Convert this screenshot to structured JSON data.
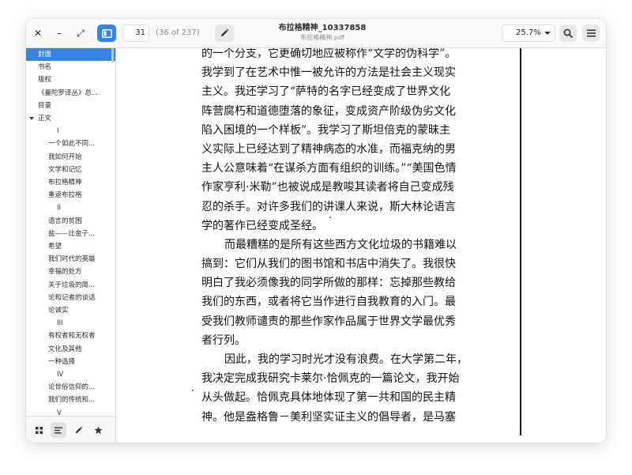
{
  "window": {
    "title": "布拉格精神_10337858",
    "subtitle": "布拉格精神.pdf",
    "controls": {
      "close": "✕",
      "minimize": "–",
      "maximize": "⤢"
    }
  },
  "toolbar": {
    "current_page": "31",
    "page_count": "(36 of 237)",
    "zoom": "25.7%",
    "icons": {
      "sidebar": "sidebar-toggle-icon",
      "annotate": "pencil-icon",
      "search": "search-icon",
      "menu": "hamburger-menu-icon"
    }
  },
  "sidebar": {
    "items": [
      {
        "label": "封面",
        "indent": 0,
        "selected": true
      },
      {
        "label": "书名",
        "indent": 0
      },
      {
        "label": "版权",
        "indent": 0
      },
      {
        "label": "《曼陀罗译丛》总...",
        "indent": 0
      },
      {
        "label": "目录",
        "indent": 0
      },
      {
        "label": "正文",
        "indent": 0,
        "expanded": true
      },
      {
        "label": "I",
        "indent": 2
      },
      {
        "label": "一个如此不同...",
        "indent": 1
      },
      {
        "label": "我如何开始",
        "indent": 1
      },
      {
        "label": "文学和记忆",
        "indent": 1
      },
      {
        "label": "布拉格精神",
        "indent": 1
      },
      {
        "label": "重返布拉格",
        "indent": 1
      },
      {
        "label": "II",
        "indent": 2
      },
      {
        "label": "语言的贫困",
        "indent": 1
      },
      {
        "label": "盐——比金子...",
        "indent": 1
      },
      {
        "label": "希望",
        "indent": 1
      },
      {
        "label": "我们时代的英雄",
        "indent": 1
      },
      {
        "label": "幸福的处方",
        "indent": 1
      },
      {
        "label": "关于垃圾的简...",
        "indent": 1
      },
      {
        "label": "论和记者的谈话",
        "indent": 1
      },
      {
        "label": "论诚实",
        "indent": 1
      },
      {
        "label": "III",
        "indent": 2
      },
      {
        "label": "有权者和无权者",
        "indent": 1
      },
      {
        "label": "文化及其他",
        "indent": 1
      },
      {
        "label": "一种选择",
        "indent": 1
      },
      {
        "label": "IV",
        "indent": 2
      },
      {
        "label": "论世俗信仰的...",
        "indent": 1
      },
      {
        "label": "我们的传统和...",
        "indent": 1
      },
      {
        "label": "V",
        "indent": 2
      }
    ],
    "footer_tabs": [
      "thumbnails-icon",
      "outline-icon",
      "annotations-icon",
      "bookmarks-icon"
    ],
    "active_tab": 1
  },
  "document": {
    "lines": [
      {
        "text": "的一个分支，它更确切地应被称作“文学的伪科学”。",
        "indent": false
      },
      {
        "text": "我学到了在艺术中惟一被允许的方法是社会主义现实",
        "indent": false
      },
      {
        "text": "主义。我还学习了“萨特的名字已经变成了世界文化",
        "indent": false
      },
      {
        "text": "阵营腐朽和道德堕落的象征，变成资产阶级伪劣文化",
        "indent": false
      },
      {
        "text": "陷入困境的一个样板”。我学习了斯坦倍克的蒙昧主",
        "indent": false
      },
      {
        "text": "义实际上已经达到了精神病态的水准，而福克纳的男",
        "indent": false
      },
      {
        "text": "主人公意味着“在谋杀方面有组织的训练。”“美国色情",
        "indent": false
      },
      {
        "text": "作家亨利·米勒”也被说成是教唆其读者将自己变成残",
        "indent": false
      },
      {
        "text": "忍的杀手。对许多我们的讲课人来说，斯大林论语言",
        "indent": false
      },
      {
        "text": "学的著作已经变成圣经。",
        "indent": false
      },
      {
        "text": "而最糟糕的是所有这些西方文化垃圾的书籍难以",
        "indent": true
      },
      {
        "text": "搞到：它们从我们的图书馆和书店中消失了。我很快",
        "indent": false
      },
      {
        "text": "明白了我必须像我的同学所做的那样：忘掉那些教给",
        "indent": false
      },
      {
        "text": "我们的东西，或者将它当作进行自我教育的入门。最",
        "indent": false
      },
      {
        "text": "受我们教师谴责的那些作家作品属于世界文学最优秀",
        "indent": false
      },
      {
        "text": "者行列。",
        "indent": false
      },
      {
        "text": "因此，我的学习时光才没有浪费。在大学第二年，",
        "indent": true
      },
      {
        "text": "我决定完成我研究卡莱尔·恰佩克的一篇论文，我开始",
        "indent": false
      },
      {
        "text": "从头做起。恰佩克具体地体现了第一共和国的民主精",
        "indent": false
      },
      {
        "text": "神。他是盎格鲁－美利坚实证主义的倡导者，是马塞",
        "indent": false
      }
    ]
  },
  "colors": {
    "accent": "#3584e4",
    "headerbar": "#fafafa",
    "sidebar_border": "#d8d8d8"
  }
}
